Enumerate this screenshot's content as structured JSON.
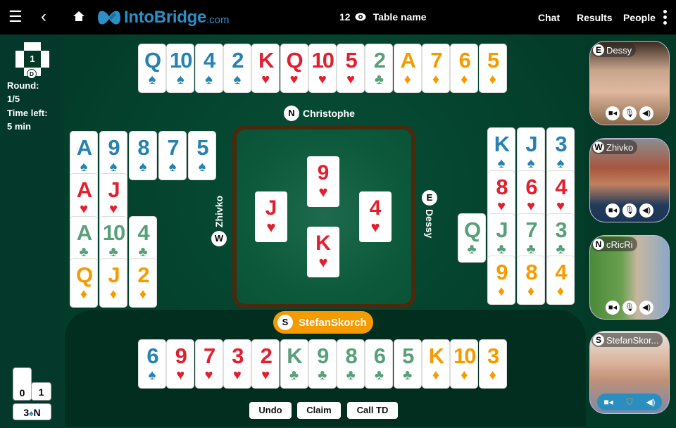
{
  "header": {
    "logo_text": "IntoBridge",
    "logo_suffix": ".com",
    "spectators": "12",
    "table_name": "Table name",
    "nav": [
      "Chat",
      "Results",
      "People"
    ],
    "icons": [
      "menu-icon",
      "back-icon",
      "home-icon",
      "eye-icon",
      "kebab-icon"
    ]
  },
  "info": {
    "board_number": "1",
    "dealer": "D",
    "round_label": "Round:",
    "round_value": "1/5",
    "time_label": "Time left:",
    "time_value": "5 min"
  },
  "score": {
    "ns_tricks": "0",
    "ew_tricks": "1",
    "contract_level": "3",
    "contract_suit": "♠",
    "declarer": "N"
  },
  "suits": {
    "S": "♠",
    "H": "♥",
    "C": "♣",
    "D": "♦"
  },
  "hands": {
    "north": {
      "seat": "N",
      "name": "Christophe",
      "cards": [
        [
          "Q",
          "S"
        ],
        [
          "10",
          "S"
        ],
        [
          "4",
          "S"
        ],
        [
          "2",
          "S"
        ],
        [
          "K",
          "H"
        ],
        [
          "Q",
          "H"
        ],
        [
          "10",
          "H"
        ],
        [
          "5",
          "H"
        ],
        [
          "2",
          "C"
        ],
        [
          "A",
          "D"
        ],
        [
          "7",
          "D"
        ],
        [
          "6",
          "D"
        ],
        [
          "5",
          "D"
        ]
      ]
    },
    "west": {
      "seat": "W",
      "name": "Zhivko",
      "rows": {
        "spades": [
          "A",
          "9",
          "8",
          "7",
          "5"
        ],
        "hearts": [
          "A",
          "J"
        ],
        "clubs": [
          "A",
          "10",
          "4"
        ],
        "diamonds": [
          "Q",
          "J",
          "2"
        ]
      }
    },
    "east": {
      "seat": "E",
      "name": "Dessy",
      "rows": {
        "spades": [
          "K",
          "J",
          "3"
        ],
        "hearts": [
          "8",
          "6",
          "4"
        ],
        "clubs": [
          "Q",
          "J",
          "7",
          "3"
        ],
        "diamonds": [
          "9",
          "8",
          "4"
        ]
      }
    },
    "south": {
      "seat": "S",
      "name": "StefanSkorch",
      "cards": [
        [
          "6",
          "S"
        ],
        [
          "9",
          "H"
        ],
        [
          "7",
          "H"
        ],
        [
          "3",
          "H"
        ],
        [
          "2",
          "H"
        ],
        [
          "K",
          "C"
        ],
        [
          "9",
          "C"
        ],
        [
          "8",
          "C"
        ],
        [
          "6",
          "C"
        ],
        [
          "5",
          "C"
        ],
        [
          "K",
          "D"
        ],
        [
          "10",
          "D"
        ],
        [
          "3",
          "D"
        ]
      ]
    }
  },
  "trick": {
    "north": [
      "9",
      "H"
    ],
    "west": [
      "J",
      "H"
    ],
    "east": [
      "4",
      "H"
    ],
    "south": [
      "K",
      "H"
    ]
  },
  "actions": {
    "undo": "Undo",
    "claim": "Claim",
    "call_td": "Call TD"
  },
  "videos": [
    {
      "seat": "E",
      "name": "Dessy",
      "controls": [
        "camera-icon",
        "mic-icon",
        "speaker-icon"
      ]
    },
    {
      "seat": "W",
      "name": "Zhivko",
      "controls": [
        "camera-icon",
        "mic-icon",
        "speaker-icon"
      ]
    },
    {
      "seat": "N",
      "name": "cRicRi",
      "controls": [
        "camera-icon",
        "mic-icon",
        "speaker-icon"
      ]
    },
    {
      "seat": "S",
      "name": "StefanSkor...",
      "controls": [
        "camera-icon",
        "shield-icon",
        "speaker-icon"
      ]
    }
  ],
  "colors": {
    "spade": "#2582b1",
    "heart": "#e21f2f",
    "club": "#57a07a",
    "diamond": "#f59b00",
    "felt": "#033a27",
    "accent": "#f59b00"
  }
}
